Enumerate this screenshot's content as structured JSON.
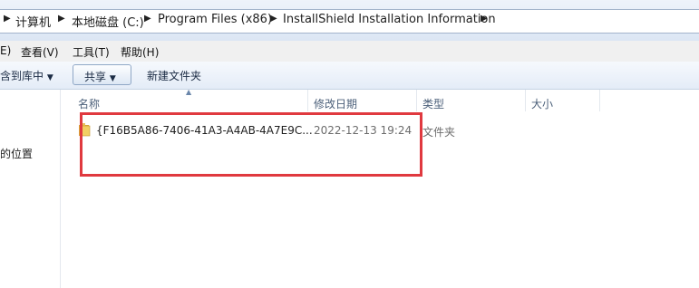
{
  "address_bar": {
    "crumbs": [
      "计算机",
      "本地磁盘 (C:)",
      "Program Files (x86)",
      "InstallShield Installation Information"
    ]
  },
  "menu": {
    "items": [
      "E)",
      "查看(V)",
      "工具(T)",
      "帮助(H)"
    ]
  },
  "command_bar": {
    "include_in_library": "含到库中",
    "share": "共享",
    "new_folder": "新建文件夹"
  },
  "nav_pane": {
    "item": "的位置"
  },
  "columns": {
    "name": "名称",
    "date_modified": "修改日期",
    "type": "类型",
    "size": "大小"
  },
  "files": [
    {
      "name": "{F16B5A86-7406-41A3-A4AB-4A7E9C...",
      "date_modified": "2022-12-13 19:24",
      "type": "文件夹",
      "icon": "folder-icon"
    }
  ],
  "colors": {
    "highlight": "#e0393f",
    "header_text": "#4c607a"
  }
}
